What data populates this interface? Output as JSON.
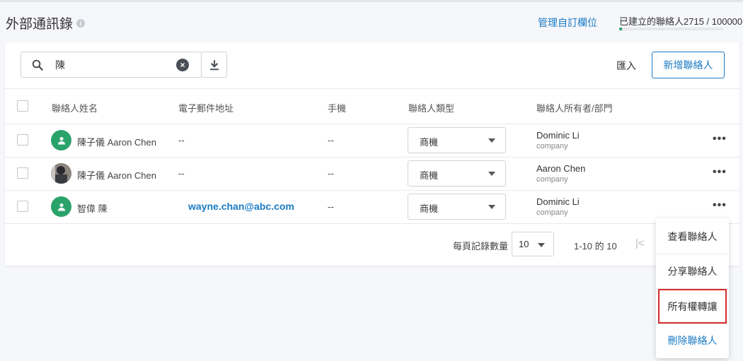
{
  "header": {
    "title": "外部通訊錄",
    "info_icon": "info-icon",
    "manage_link": "管理自訂欄位",
    "quota_text": "已建立的聯絡人2715 / 100000",
    "quota_fraction": 0.027
  },
  "toolbar": {
    "search_value": "陳",
    "import_label": "匯入",
    "add_label": "新增聯絡人"
  },
  "table": {
    "columns": [
      "聯絡人姓名",
      "電子郵件地址",
      "手機",
      "聯絡人類型",
      "聯絡人所有者/部門"
    ],
    "rows": [
      {
        "name": "陳子儀 Aaron Chen",
        "email": "--",
        "phone": "--",
        "type": "商機",
        "owner": "Dominic Li",
        "dept": "company",
        "avatar": "person-icon"
      },
      {
        "name": "陳子儀 Aaron Chen",
        "email": "--",
        "phone": "--",
        "type": "商機",
        "owner": "Aaron Chen",
        "dept": "company",
        "avatar": "photo"
      },
      {
        "name": "智偉 陳",
        "email": "wayne.chan@abc.com",
        "phone": "--",
        "type": "商機",
        "owner": "Dominic Li",
        "dept": "company",
        "avatar": "person-icon"
      }
    ]
  },
  "footer": {
    "per_page_label": "每頁記錄數量",
    "per_page_value": "10",
    "range_text": "1-10 的 10"
  },
  "context_menu": {
    "items": [
      "查看聯絡人",
      "分享聯絡人",
      "所有權轉讓",
      "刪除聯絡人"
    ]
  },
  "colors": {
    "accent": "#1b7bc4",
    "avatar_green": "#2aa36b",
    "highlight_red": "#d62c2c"
  }
}
